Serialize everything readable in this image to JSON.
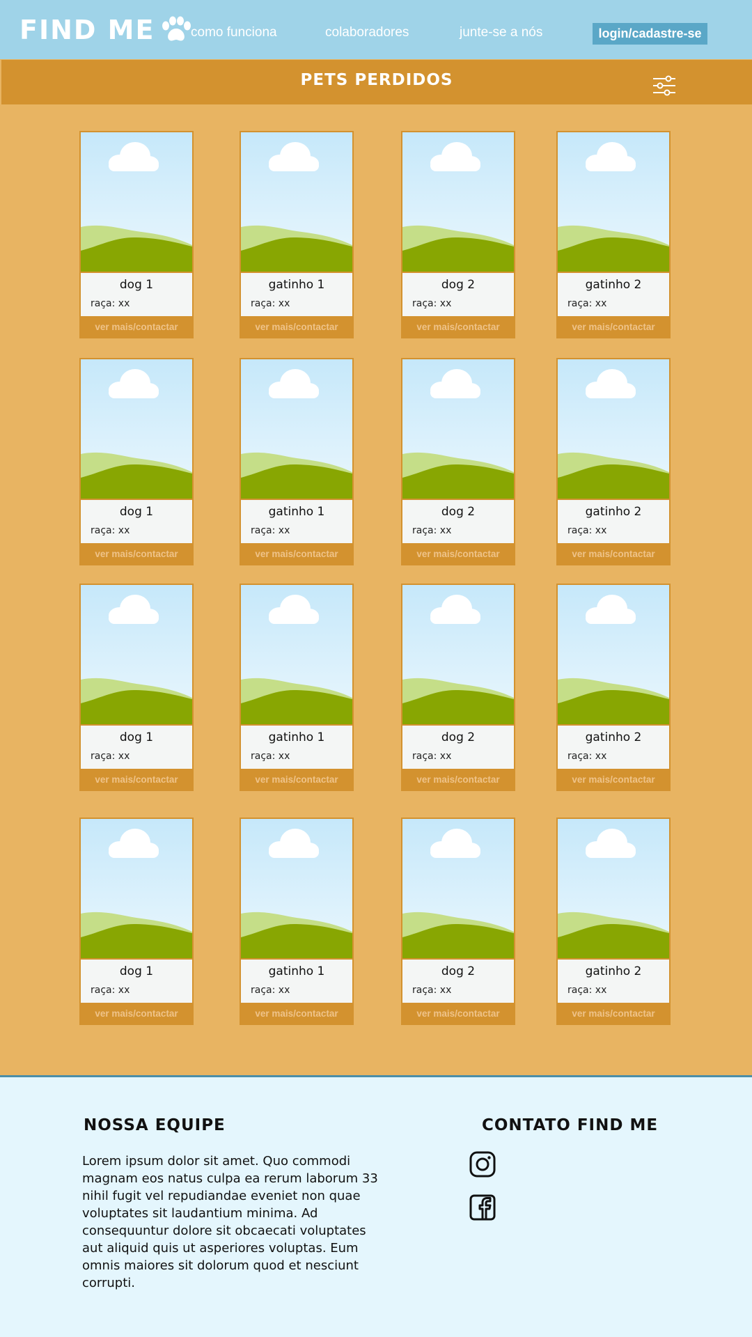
{
  "header": {
    "logo_text": "FIND ME",
    "nav": [
      "como funciona",
      "colaboradores",
      "junte-se a nós"
    ],
    "login_label": "login/cadastre-se"
  },
  "title": "PETS PERDIDOS",
  "filter_icon": "sliders-icon",
  "cards": [
    {
      "name": "dog 1",
      "breed": "raça: xx",
      "button": "ver mais/contactar"
    },
    {
      "name": "gatinho 1",
      "breed": "raça: xx",
      "button": "ver mais/contactar"
    },
    {
      "name": "dog 2",
      "breed": "raça: xx",
      "button": "ver mais/contactar"
    },
    {
      "name": "gatinho 2",
      "breed": "raça: xx",
      "button": "ver mais/contactar"
    },
    {
      "name": "dog 1",
      "breed": "raça: xx",
      "button": "ver mais/contactar"
    },
    {
      "name": "gatinho 1",
      "breed": "raça: xx",
      "button": "ver mais/contactar"
    },
    {
      "name": "dog 2",
      "breed": "raça: xx",
      "button": "ver mais/contactar"
    },
    {
      "name": "gatinho 2",
      "breed": "raça: xx",
      "button": "ver mais/contactar"
    },
    {
      "name": "dog 1",
      "breed": "raça: xx",
      "button": "ver mais/contactar"
    },
    {
      "name": "gatinho 1",
      "breed": "raça: xx",
      "button": "ver mais/contactar"
    },
    {
      "name": "dog 2",
      "breed": "raça: xx",
      "button": "ver mais/contactar"
    },
    {
      "name": "gatinho 2",
      "breed": "raça: xx",
      "button": "ver mais/contactar"
    },
    {
      "name": "dog 1",
      "breed": "raça: xx",
      "button": "ver mais/contactar"
    },
    {
      "name": "gatinho 1",
      "breed": "raça: xx",
      "button": "ver mais/contactar"
    },
    {
      "name": "dog 2",
      "breed": "raça: xx",
      "button": "ver mais/contactar"
    },
    {
      "name": "gatinho 2",
      "breed": "raça: xx",
      "button": "ver mais/contactar"
    }
  ],
  "footer": {
    "team_title": "NOSSA EQUIPE",
    "team_text": "  Lorem ipsum dolor sit amet. Quo commodi magnam eos natus culpa ea rerum laborum 33 nihil fugit vel repudiandae eveniet non quae voluptates sit laudantium minima. Ad consequuntur dolore sit obcaecati voluptates aut aliquid quis ut asperiores voluptas. Eum omnis maiores sit dolorum quod et nesciunt corrupti.",
    "contact_title": "CONTATO FIND ME",
    "icons": [
      "instagram-icon",
      "facebook-icon"
    ]
  },
  "colors": {
    "header_bg": "#9fd3e8",
    "title_bar": "#d3922f",
    "page_bg": "#e8b462",
    "login_button": "#5aa7c7",
    "footer_bg": "#e4f6fd"
  }
}
